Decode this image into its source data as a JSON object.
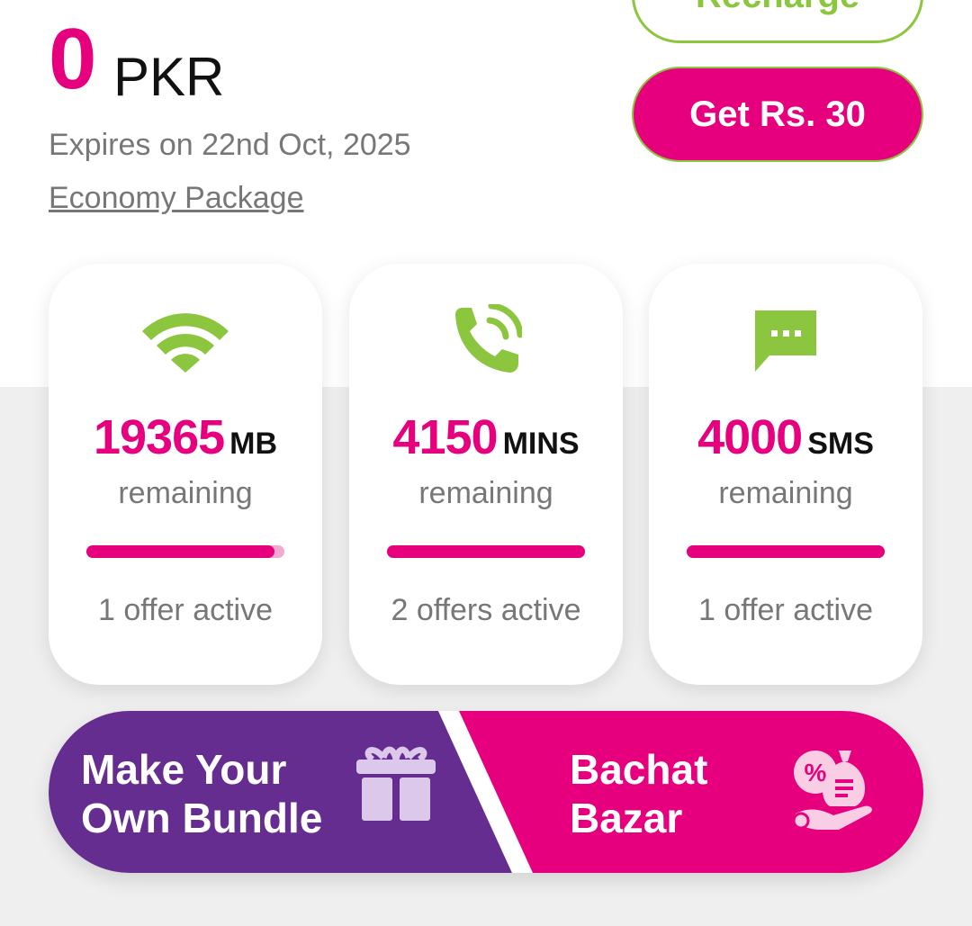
{
  "balance": {
    "amount": "0",
    "currency": "PKR",
    "expiry_text": "Expires on 22nd Oct, 2025",
    "package_name": "Economy Package"
  },
  "buttons": {
    "recharge_label": "Recharge",
    "get_offer_label": "Get Rs. 30"
  },
  "cards": [
    {
      "icon": "wifi-icon",
      "value": "19365",
      "unit": "MB",
      "remaining_label": "remaining",
      "progress": 0.95,
      "offers_text": "1 offer active"
    },
    {
      "icon": "phone-call-icon",
      "value": "4150",
      "unit": "MINS",
      "remaining_label": "remaining",
      "progress": 1.0,
      "offers_text": "2 offers active"
    },
    {
      "icon": "sms-icon",
      "value": "4000",
      "unit": "SMS",
      "remaining_label": "remaining",
      "progress": 1.0,
      "offers_text": "1 offer active"
    }
  ],
  "promo": {
    "left_line1": "Make Your",
    "left_line2": "Own Bundle",
    "right_line1": "Bachat",
    "right_line2": "Bazar",
    "left_icon": "gift-icon",
    "right_icon": "money-bag-discount-icon"
  },
  "colors": {
    "accent_pink": "#e6007e",
    "accent_green": "#8cc63f",
    "promo_purple": "#662d91"
  }
}
